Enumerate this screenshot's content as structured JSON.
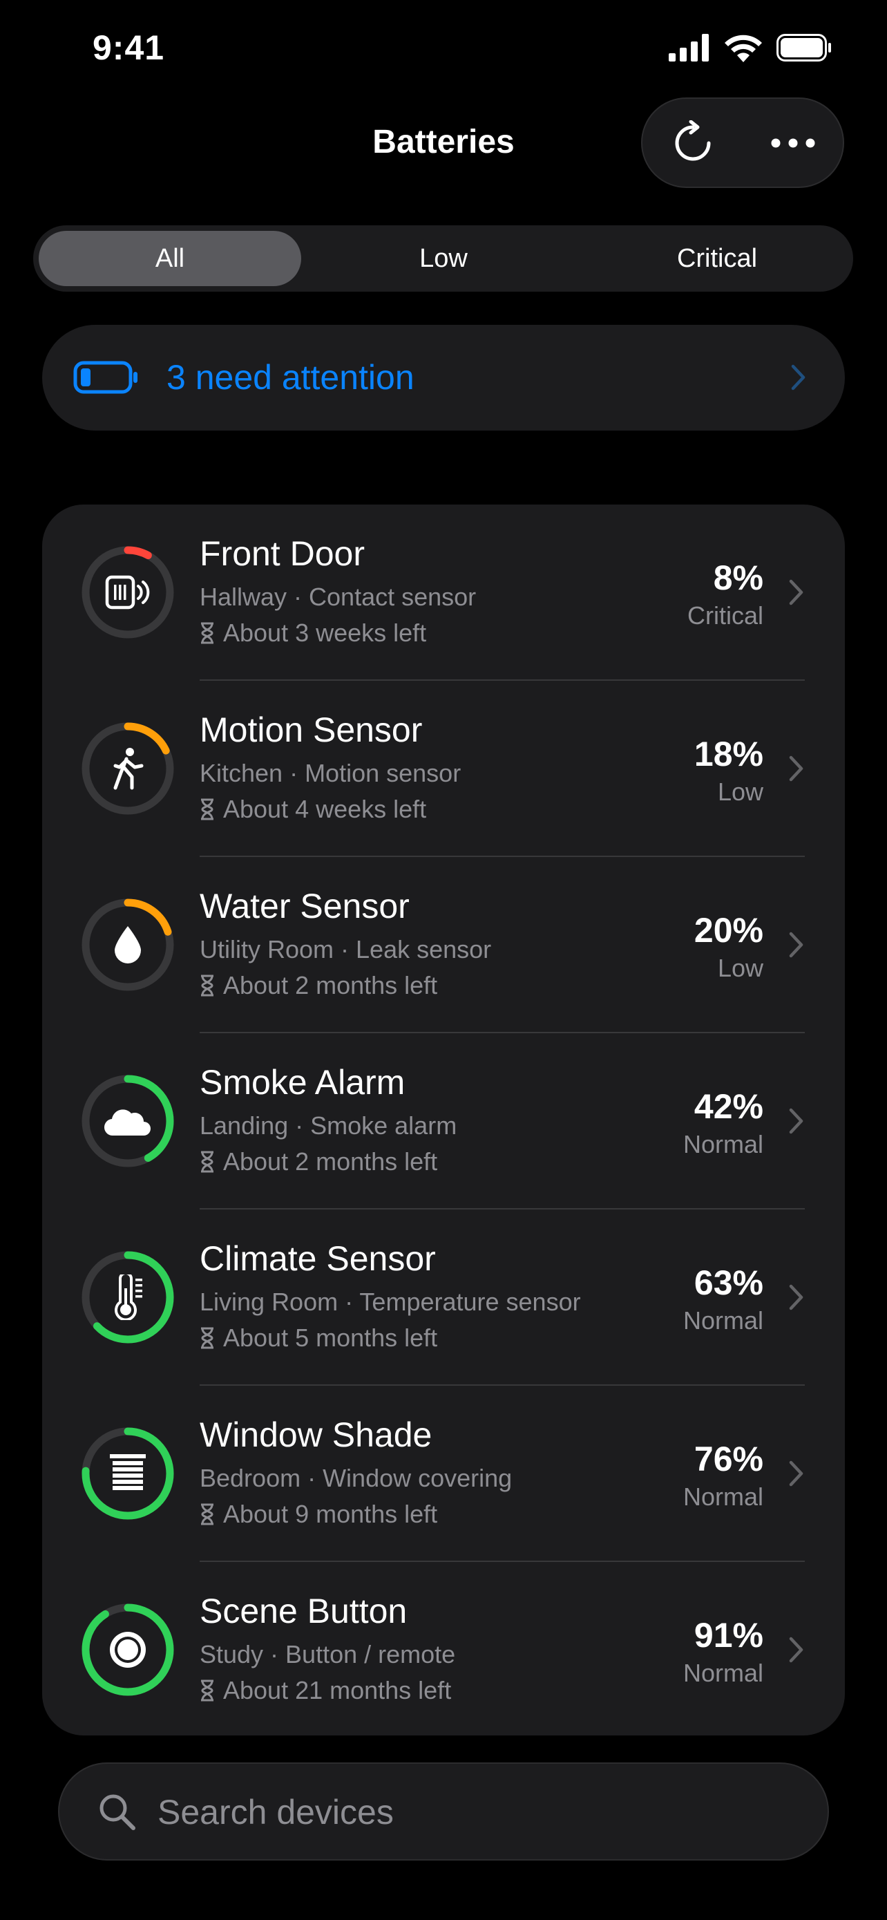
{
  "status_bar": {
    "time": "9:41"
  },
  "header": {
    "title": "Batteries"
  },
  "segments": [
    {
      "label": "All",
      "active": true
    },
    {
      "label": "Low",
      "active": false
    },
    {
      "label": "Critical",
      "active": false
    }
  ],
  "attention": {
    "text": "3 need attention",
    "color": "#0a84ff"
  },
  "devices": [
    {
      "name": "Front Door",
      "subtitle": "Hallway · Contact sensor",
      "time_left": "About 3 weeks left",
      "percent": "8%",
      "level": 8,
      "status": "Critical",
      "ring_color": "#ff453a",
      "icon": "contact-sensor-icon"
    },
    {
      "name": "Motion Sensor",
      "subtitle": "Kitchen · Motion sensor",
      "time_left": "About 4 weeks left",
      "percent": "18%",
      "level": 18,
      "status": "Low",
      "ring_color": "#ff9f0a",
      "icon": "walking-person-icon"
    },
    {
      "name": "Water Sensor",
      "subtitle": "Utility Room · Leak sensor",
      "time_left": "About 2 months left",
      "percent": "20%",
      "level": 20,
      "status": "Low",
      "ring_color": "#ff9f0a",
      "icon": "water-drop-icon"
    },
    {
      "name": "Smoke Alarm",
      "subtitle": "Landing · Smoke alarm",
      "time_left": "About 2 months left",
      "percent": "42%",
      "level": 42,
      "status": "Normal",
      "ring_color": "#30d158",
      "icon": "smoke-cloud-icon"
    },
    {
      "name": "Climate Sensor",
      "subtitle": "Living Room · Temperature sensor",
      "time_left": "About 5 months left",
      "percent": "63%",
      "level": 63,
      "status": "Normal",
      "ring_color": "#30d158",
      "icon": "thermometer-icon"
    },
    {
      "name": "Window Shade",
      "subtitle": "Bedroom · Window covering",
      "time_left": "About 9 months left",
      "percent": "76%",
      "level": 76,
      "status": "Normal",
      "ring_color": "#30d158",
      "icon": "window-shade-icon"
    },
    {
      "name": "Scene Button",
      "subtitle": "Study · Button / remote",
      "time_left": "About 21 months left",
      "percent": "91%",
      "level": 91,
      "status": "Normal",
      "ring_color": "#30d158",
      "icon": "scene-button-icon"
    }
  ],
  "search": {
    "placeholder": "Search devices"
  }
}
